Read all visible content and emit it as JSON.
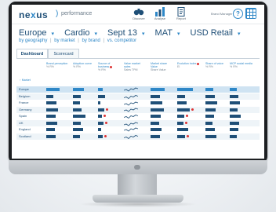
{
  "header": {
    "brand_a": "ne",
    "brand_x": "x",
    "brand_b": "us",
    "separator": ")",
    "subtitle": "performance",
    "discover_label": "Discover",
    "analyse_label": "Analyse",
    "report_label": "Report",
    "user_label": "Brand Manager",
    "help_label": "?"
  },
  "filters": [
    {
      "label": "Europe"
    },
    {
      "label": "Cardio"
    },
    {
      "label": "Sept 13"
    },
    {
      "label": "MAT"
    },
    {
      "label": "USD Retail"
    }
  ],
  "view_links": {
    "a": "by geography",
    "b": "by market",
    "c": "by brand",
    "d": "vs. competitor",
    "sep": "|"
  },
  "tabs": [
    "Dashboard",
    "Scorecard"
  ],
  "table": {
    "market_header": "↑ Market",
    "columns": [
      {
        "label": "Brand perception",
        "sub": "% R%"
      },
      {
        "label": "Adoption curve",
        "sub": "% R%"
      },
      {
        "label": "Source of business",
        "sub": "% R%",
        "flag": true
      },
      {
        "label": "Value market sales",
        "sub": "Sales TPM"
      },
      {
        "label": "Market share Value",
        "sub": "Share Value"
      },
      {
        "label": "Evolution index",
        "sub": "EI",
        "flag": true
      },
      {
        "label": "Share of voice",
        "sub": "% R%"
      },
      {
        "label": "MCP social media",
        "sub": "% R%"
      }
    ],
    "rows": [
      {
        "market": "Europe",
        "v": [
          "",
          "",
          "",
          "",
          "",
          "",
          "",
          ""
        ]
      },
      {
        "market": "Belgium",
        "v": [
          "",
          "",
          "",
          "",
          "",
          "",
          "",
          ""
        ]
      },
      {
        "market": "France",
        "v": [
          "",
          "",
          "",
          "",
          "",
          "",
          "",
          ""
        ]
      },
      {
        "market": "Germany",
        "v": [
          "",
          "",
          "",
          "",
          "",
          "",
          "",
          ""
        ]
      },
      {
        "market": "Spain",
        "v": [
          "",
          "",
          "",
          "",
          "",
          "",
          "",
          ""
        ]
      },
      {
        "market": "UK",
        "v": [
          "",
          "",
          "",
          "",
          "",
          "",
          "",
          ""
        ]
      },
      {
        "market": "England",
        "v": [
          "",
          "",
          "",
          "",
          "",
          "",
          "",
          ""
        ]
      },
      {
        "market": "Scotland",
        "v": [
          "",
          "",
          "",
          "",
          "",
          "",
          "",
          ""
        ]
      }
    ]
  },
  "colors": {
    "accent": "#2e87c7",
    "navy": "#1f4f77",
    "flag_red": "#d33333"
  }
}
